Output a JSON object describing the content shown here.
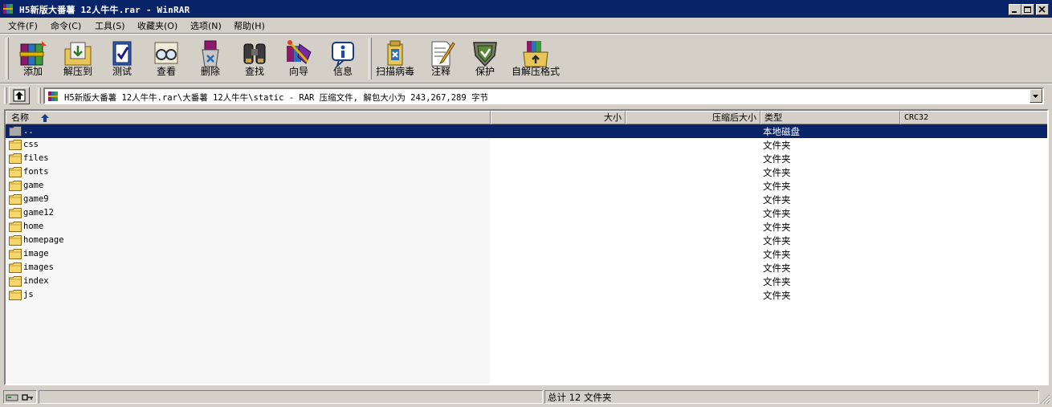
{
  "window": {
    "title": "H5新版大番薯 12人牛牛.rar - WinRAR",
    "colors": {
      "titlebar": "#0a246a",
      "selection": "#0a246a",
      "face": "#d4d0c8"
    }
  },
  "menu": [
    {
      "label": "文件(F)"
    },
    {
      "label": "命令(C)"
    },
    {
      "label": "工具(S)"
    },
    {
      "label": "收藏夹(O)"
    },
    {
      "label": "选项(N)"
    },
    {
      "label": "帮助(H)"
    }
  ],
  "toolbar": {
    "buttons": [
      {
        "label": "添加",
        "icon": "add-books-icon"
      },
      {
        "label": "解压到",
        "icon": "extract-folder-icon"
      },
      {
        "label": "测试",
        "icon": "test-book-icon"
      },
      {
        "label": "查看",
        "icon": "view-glasses-icon"
      },
      {
        "label": "删除",
        "icon": "delete-recycle-icon"
      },
      {
        "label": "查找",
        "icon": "find-binoculars-icon"
      },
      {
        "label": "向导",
        "icon": "wizard-icon"
      },
      {
        "label": "信息",
        "icon": "info-icon"
      },
      {
        "label": "扫描病毒",
        "icon": "virus-scan-icon"
      },
      {
        "label": "注释",
        "icon": "comment-icon"
      },
      {
        "label": "保护",
        "icon": "protect-shield-icon"
      },
      {
        "label": "自解压格式",
        "icon": "sfx-box-icon"
      }
    ]
  },
  "address": {
    "path": "H5新版大番薯 12人牛牛.rar\\大番薯 12人牛牛\\static - RAR 压缩文件, 解包大小为 243,267,289 字节"
  },
  "list": {
    "columns": {
      "name": "名称",
      "size": "大小",
      "packed": "压缩后大小",
      "type": "类型",
      "crc": "CRC32"
    },
    "rows": [
      {
        "name": "..",
        "type": "本地磁盘",
        "selected": true
      },
      {
        "name": "css",
        "type": "文件夹"
      },
      {
        "name": "files",
        "type": "文件夹"
      },
      {
        "name": "fonts",
        "type": "文件夹"
      },
      {
        "name": "game",
        "type": "文件夹"
      },
      {
        "name": "game9",
        "type": "文件夹"
      },
      {
        "name": "game12",
        "type": "文件夹"
      },
      {
        "name": "home",
        "type": "文件夹"
      },
      {
        "name": "homepage",
        "type": "文件夹"
      },
      {
        "name": "image",
        "type": "文件夹"
      },
      {
        "name": "images",
        "type": "文件夹"
      },
      {
        "name": "index",
        "type": "文件夹"
      },
      {
        "name": "js",
        "type": "文件夹"
      }
    ]
  },
  "status": {
    "summary": "总计 12 文件夹"
  }
}
